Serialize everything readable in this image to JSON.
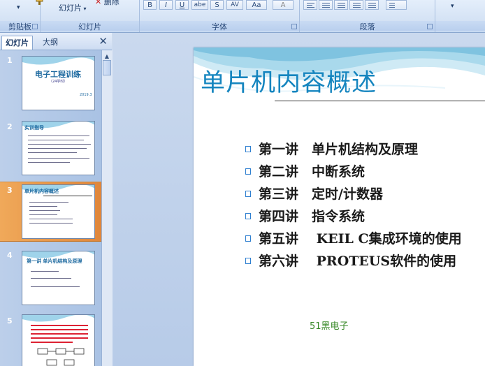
{
  "ribbon": {
    "groups": {
      "clipboard": "剪贴板",
      "slides": "幻灯片",
      "font": "字体",
      "paragraph": "段落"
    },
    "slide_button": "幻灯片",
    "delete_button": "删除",
    "font_buttons": [
      "B",
      "I",
      "U",
      "abe",
      "S",
      "AV",
      "Aa",
      "A"
    ]
  },
  "panel": {
    "tab_slides": "幻灯片",
    "tab_outline": "大纲",
    "close_icon": "close-icon"
  },
  "thumbnails": [
    {
      "num": "1",
      "title": "电子工程训练",
      "sub": "（24学时）",
      "date": "2019.3"
    },
    {
      "num": "2",
      "title": "实训指导"
    },
    {
      "num": "3",
      "title": "单片机内容概述"
    },
    {
      "num": "4",
      "title": "第一讲 单片机结构及原理"
    },
    {
      "num": "5"
    }
  ],
  "slide": {
    "title": "单片机内容概述",
    "bullets": [
      "第一讲　单片机结构及原理",
      "第二讲　中断系统",
      "第三讲　定时/计数器",
      "第四讲　指令系统",
      "第五讲　 KEIL  C集成环境的使用",
      "第六讲　 PROTEUS软件的使用"
    ],
    "footer": "51黑电子"
  },
  "colors": {
    "title": "#1585bf",
    "bullet_box": "#2e7fd0",
    "selected_thumb": "#e0863a",
    "footer": "#3a8a2a"
  }
}
